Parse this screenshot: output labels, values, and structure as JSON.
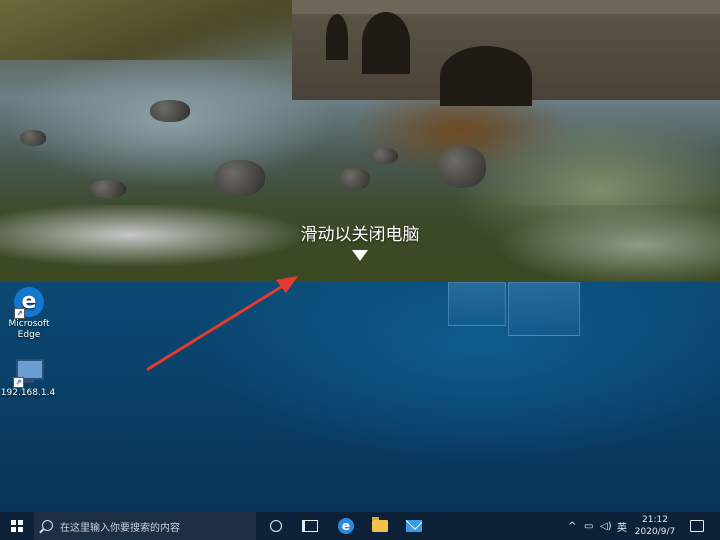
{
  "lock_screen": {
    "slide_prompt": "滑动以关闭电脑"
  },
  "desktop": {
    "icons": [
      {
        "label_line1": "Microsoft",
        "label_line2": "Edge",
        "icon": "edge-icon"
      },
      {
        "label_line1": "192.168.1.4",
        "label_line2": "",
        "icon": "remote-desktop-icon"
      }
    ]
  },
  "taskbar": {
    "search_placeholder": "在这里输入你要搜索的内容",
    "input_indicator": "英",
    "time": "21:12",
    "date": "2020/9/7"
  },
  "colors": {
    "desktop_bg": "#0b4a75",
    "taskbar_bg": "#0d2238",
    "annotation_arrow": "#e53a2e"
  }
}
